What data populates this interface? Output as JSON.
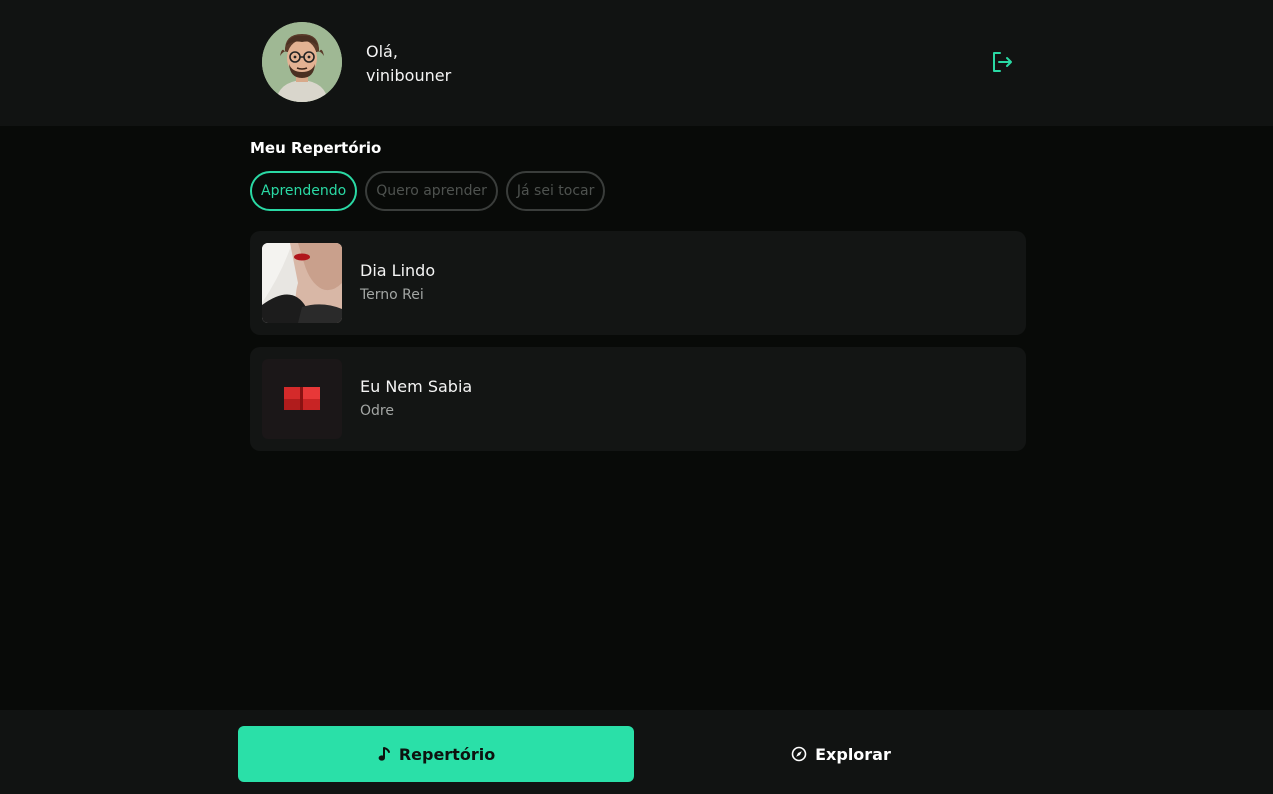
{
  "header": {
    "greeting_line1": "Olá,",
    "username": "vinibouner",
    "logout_icon": "logout-icon"
  },
  "repertoire": {
    "title": "Meu Repertório",
    "tabs": [
      {
        "label": "Aprendendo",
        "active": true
      },
      {
        "label": "Quero aprender",
        "active": false
      },
      {
        "label": "Já sei tocar",
        "active": false
      }
    ],
    "songs": [
      {
        "title": "Dia Lindo",
        "artist": "Terno Rei"
      },
      {
        "title": "Eu Nem Sabia",
        "artist": "Odre"
      }
    ]
  },
  "bottom_nav": {
    "items": [
      {
        "label": "Repertório",
        "icon": "music-note-icon",
        "active": true
      },
      {
        "label": "Explorar",
        "icon": "compass-icon",
        "active": false
      }
    ]
  },
  "colors": {
    "accent": "#2ae0a8",
    "background": "#080a08",
    "surface": "#131514"
  }
}
